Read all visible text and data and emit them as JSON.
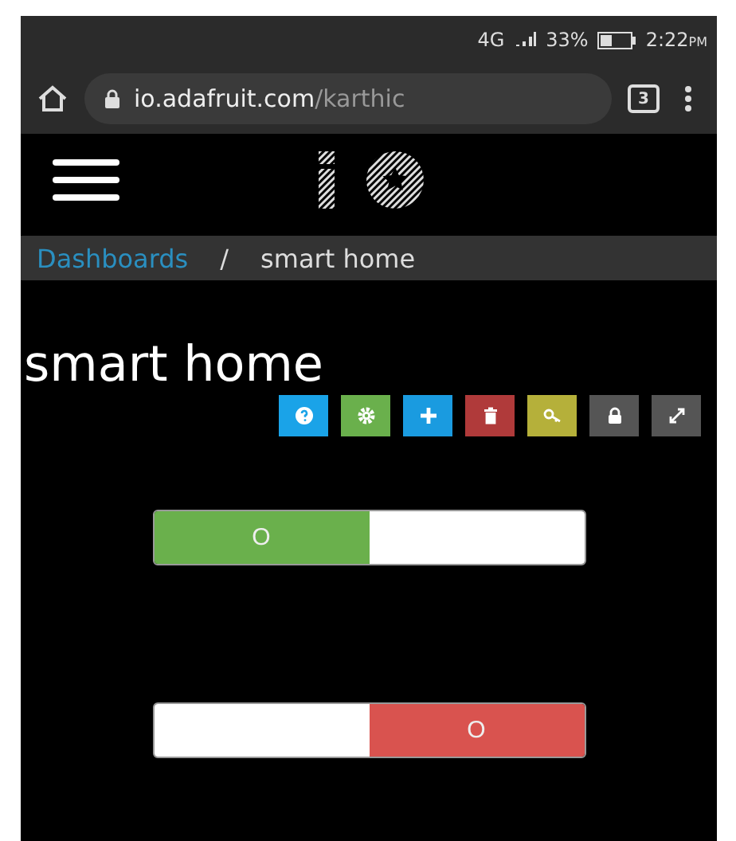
{
  "status_bar": {
    "network": "4G",
    "battery": "33%",
    "time": "2:22",
    "ampm": "PM"
  },
  "browser": {
    "url_host": "io.adafruit.com",
    "url_path": "/karthic",
    "tab_count": "3"
  },
  "breadcrumb": {
    "parent": "Dashboards",
    "separator": "/",
    "current": "smart home"
  },
  "title": "smart home",
  "toolbar": [
    {
      "kind": "help",
      "color": "#1aa3e8"
    },
    {
      "kind": "settings",
      "color": "#6ab04c"
    },
    {
      "kind": "add",
      "color": "#1a9be0"
    },
    {
      "kind": "delete",
      "color": "#b03a3a"
    },
    {
      "kind": "key",
      "color": "#b5b03a"
    },
    {
      "kind": "lock",
      "color": "#555555"
    },
    {
      "kind": "expand",
      "color": "#555555"
    }
  ],
  "toggles": [
    {
      "label": "O",
      "on": true
    },
    {
      "label": "O",
      "on": false
    }
  ]
}
